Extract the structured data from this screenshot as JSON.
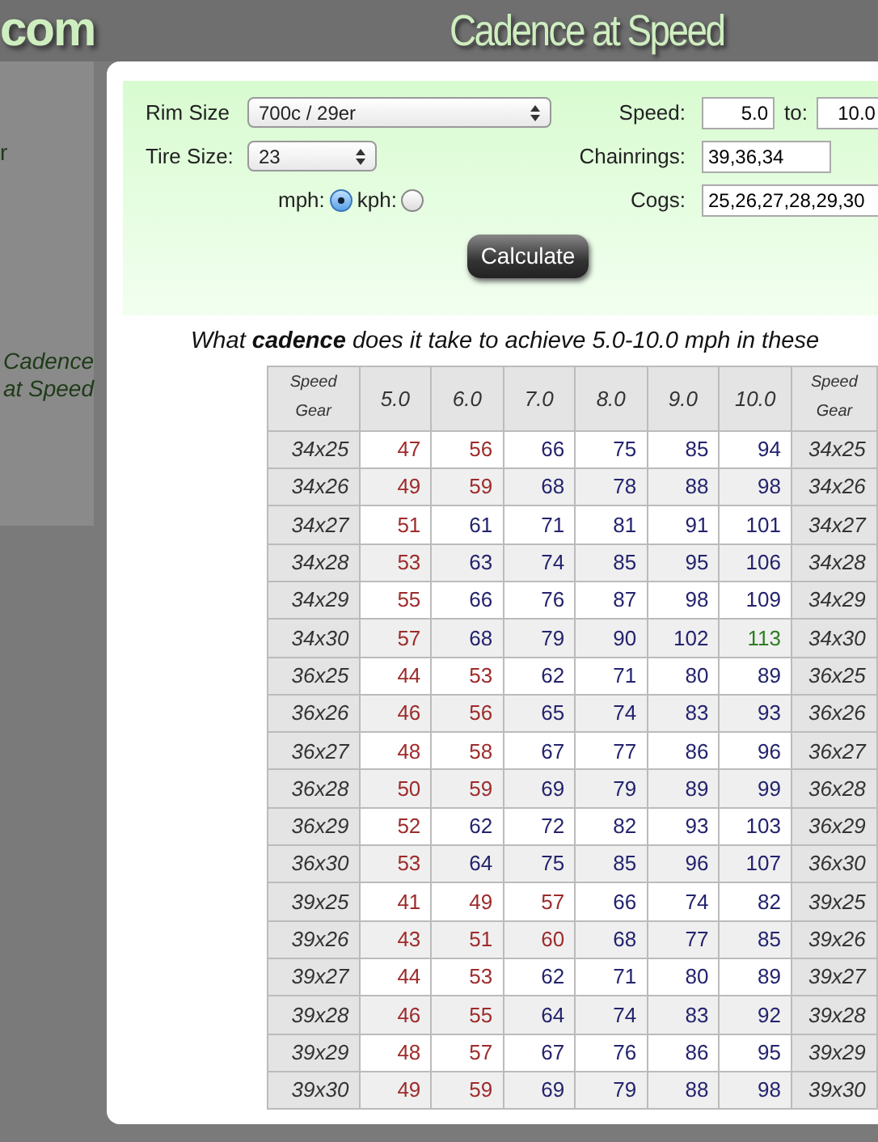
{
  "header": {
    "logo": "com",
    "title": "Cadence at Speed"
  },
  "sidebar": {
    "items": [
      {
        "label": "r",
        "selected": false
      },
      {
        "label": "Cadence at Speed",
        "selected": true
      }
    ]
  },
  "form": {
    "rim_size": {
      "label": "Rim Size",
      "value": "700c / 29er"
    },
    "tire_size": {
      "label": "Tire Size:",
      "value": "23"
    },
    "units": [
      {
        "label": "mph:",
        "selected": true
      },
      {
        "label": "kph:",
        "selected": false
      }
    ],
    "speed": {
      "label": "Speed:",
      "from": "5.0",
      "to_label": "to:",
      "to": "10.0"
    },
    "chainrings": {
      "label": "Chainrings:",
      "value": "39,36,34"
    },
    "cogs": {
      "label": "Cogs:",
      "value": "25,26,27,28,29,30"
    },
    "button": "Calculate"
  },
  "question": "What **cadence** does it take to achieve 5.0-10.0 mph in these",
  "table": {
    "corner_top": "Speed",
    "corner_bottom": "Gear",
    "columns": [
      "5.0",
      "6.0",
      "7.0",
      "8.0",
      "9.0",
      "10.0"
    ],
    "end_top": "Speed",
    "end_bottom": "Gear",
    "rows": [
      {
        "gear_end": "34x25",
        "gear": "34x25",
        "cells": [
          {
            "value": "47",
            "color": "#9e2b2b"
          },
          {
            "value": "56",
            "color": "#9e2b2b"
          },
          {
            "value": "66",
            "color": "#23236e"
          },
          {
            "value": "75",
            "color": "#23236e"
          },
          {
            "value": "85",
            "color": "#23236e"
          },
          {
            "value": "94",
            "color": "#23236e"
          }
        ]
      },
      {
        "gear_end": "34x26",
        "gear": "34x26",
        "cells": [
          {
            "value": "49",
            "color": "#9e2b2b"
          },
          {
            "value": "59",
            "color": "#9e2b2b"
          },
          {
            "value": "68",
            "color": "#23236e"
          },
          {
            "value": "78",
            "color": "#23236e"
          },
          {
            "value": "88",
            "color": "#23236e"
          },
          {
            "value": "98",
            "color": "#23236e"
          }
        ]
      },
      {
        "gear_end": "34x27",
        "gear": "34x27",
        "cells": [
          {
            "value": "51",
            "color": "#9e2b2b"
          },
          {
            "value": "61",
            "color": "#23236e"
          },
          {
            "value": "71",
            "color": "#23236e"
          },
          {
            "value": "81",
            "color": "#23236e"
          },
          {
            "value": "91",
            "color": "#23236e"
          },
          {
            "value": "101",
            "color": "#23236e"
          }
        ]
      },
      {
        "gear_end": "34x28",
        "gear": "34x28",
        "cells": [
          {
            "value": "53",
            "color": "#9e2b2b"
          },
          {
            "value": "63",
            "color": "#23236e"
          },
          {
            "value": "74",
            "color": "#23236e"
          },
          {
            "value": "85",
            "color": "#23236e"
          },
          {
            "value": "95",
            "color": "#23236e"
          },
          {
            "value": "106",
            "color": "#23236e"
          }
        ]
      },
      {
        "gear_end": "34x29",
        "gear": "34x29",
        "cells": [
          {
            "value": "55",
            "color": "#9e2b2b"
          },
          {
            "value": "66",
            "color": "#23236e"
          },
          {
            "value": "76",
            "color": "#23236e"
          },
          {
            "value": "87",
            "color": "#23236e"
          },
          {
            "value": "98",
            "color": "#23236e"
          },
          {
            "value": "109",
            "color": "#23236e"
          }
        ]
      },
      {
        "gear_end": "34x30",
        "gear": "34x30",
        "cells": [
          {
            "value": "57",
            "color": "#9e2b2b"
          },
          {
            "value": "68",
            "color": "#23236e"
          },
          {
            "value": "79",
            "color": "#23236e"
          },
          {
            "value": "90",
            "color": "#23236e"
          },
          {
            "value": "102",
            "color": "#23236e"
          },
          {
            "value": "113",
            "color": "#2e7d23"
          }
        ]
      },
      {
        "gear_end": "36x25",
        "gear": "36x25",
        "cells": [
          {
            "value": "44",
            "color": "#9e2b2b"
          },
          {
            "value": "53",
            "color": "#9e2b2b"
          },
          {
            "value": "62",
            "color": "#23236e"
          },
          {
            "value": "71",
            "color": "#23236e"
          },
          {
            "value": "80",
            "color": "#23236e"
          },
          {
            "value": "89",
            "color": "#23236e"
          }
        ]
      },
      {
        "gear_end": "36x26",
        "gear": "36x26",
        "cells": [
          {
            "value": "46",
            "color": "#9e2b2b"
          },
          {
            "value": "56",
            "color": "#9e2b2b"
          },
          {
            "value": "65",
            "color": "#23236e"
          },
          {
            "value": "74",
            "color": "#23236e"
          },
          {
            "value": "83",
            "color": "#23236e"
          },
          {
            "value": "93",
            "color": "#23236e"
          }
        ]
      },
      {
        "gear_end": "36x27",
        "gear": "36x27",
        "cells": [
          {
            "value": "48",
            "color": "#9e2b2b"
          },
          {
            "value": "58",
            "color": "#9e2b2b"
          },
          {
            "value": "67",
            "color": "#23236e"
          },
          {
            "value": "77",
            "color": "#23236e"
          },
          {
            "value": "86",
            "color": "#23236e"
          },
          {
            "value": "96",
            "color": "#23236e"
          }
        ]
      },
      {
        "gear_end": "36x28",
        "gear": "36x28",
        "cells": [
          {
            "value": "50",
            "color": "#9e2b2b"
          },
          {
            "value": "59",
            "color": "#9e2b2b"
          },
          {
            "value": "69",
            "color": "#23236e"
          },
          {
            "value": "79",
            "color": "#23236e"
          },
          {
            "value": "89",
            "color": "#23236e"
          },
          {
            "value": "99",
            "color": "#23236e"
          }
        ]
      },
      {
        "gear_end": "36x29",
        "gear": "36x29",
        "cells": [
          {
            "value": "52",
            "color": "#9e2b2b"
          },
          {
            "value": "62",
            "color": "#23236e"
          },
          {
            "value": "72",
            "color": "#23236e"
          },
          {
            "value": "82",
            "color": "#23236e"
          },
          {
            "value": "93",
            "color": "#23236e"
          },
          {
            "value": "103",
            "color": "#23236e"
          }
        ]
      },
      {
        "gear_end": "36x30",
        "gear": "36x30",
        "cells": [
          {
            "value": "53",
            "color": "#9e2b2b"
          },
          {
            "value": "64",
            "color": "#23236e"
          },
          {
            "value": "75",
            "color": "#23236e"
          },
          {
            "value": "85",
            "color": "#23236e"
          },
          {
            "value": "96",
            "color": "#23236e"
          },
          {
            "value": "107",
            "color": "#23236e"
          }
        ]
      },
      {
        "gear_end": "39x25",
        "gear": "39x25",
        "cells": [
          {
            "value": "41",
            "color": "#9e2b2b"
          },
          {
            "value": "49",
            "color": "#9e2b2b"
          },
          {
            "value": "57",
            "color": "#9e2b2b"
          },
          {
            "value": "66",
            "color": "#23236e"
          },
          {
            "value": "74",
            "color": "#23236e"
          },
          {
            "value": "82",
            "color": "#23236e"
          }
        ]
      },
      {
        "gear_end": "39x26",
        "gear": "39x26",
        "cells": [
          {
            "value": "43",
            "color": "#9e2b2b"
          },
          {
            "value": "51",
            "color": "#9e2b2b"
          },
          {
            "value": "60",
            "color": "#9e2b2b"
          },
          {
            "value": "68",
            "color": "#23236e"
          },
          {
            "value": "77",
            "color": "#23236e"
          },
          {
            "value": "85",
            "color": "#23236e"
          }
        ]
      },
      {
        "gear_end": "39x27",
        "gear": "39x27",
        "cells": [
          {
            "value": "44",
            "color": "#9e2b2b"
          },
          {
            "value": "53",
            "color": "#9e2b2b"
          },
          {
            "value": "62",
            "color": "#23236e"
          },
          {
            "value": "71",
            "color": "#23236e"
          },
          {
            "value": "80",
            "color": "#23236e"
          },
          {
            "value": "89",
            "color": "#23236e"
          }
        ]
      },
      {
        "gear_end": "39x28",
        "gear": "39x28",
        "cells": [
          {
            "value": "46",
            "color": "#9e2b2b"
          },
          {
            "value": "55",
            "color": "#9e2b2b"
          },
          {
            "value": "64",
            "color": "#23236e"
          },
          {
            "value": "74",
            "color": "#23236e"
          },
          {
            "value": "83",
            "color": "#23236e"
          },
          {
            "value": "92",
            "color": "#23236e"
          }
        ]
      },
      {
        "gear_end": "39x29",
        "gear": "39x29",
        "cells": [
          {
            "value": "48",
            "color": "#9e2b2b"
          },
          {
            "value": "57",
            "color": "#9e2b2b"
          },
          {
            "value": "67",
            "color": "#23236e"
          },
          {
            "value": "76",
            "color": "#23236e"
          },
          {
            "value": "86",
            "color": "#23236e"
          },
          {
            "value": "95",
            "color": "#23236e"
          }
        ]
      },
      {
        "gear_end": "39x30",
        "gear": "39x30",
        "cells": [
          {
            "value": "49",
            "color": "#9e2b2b"
          },
          {
            "value": "59",
            "color": "#9e2b2b"
          },
          {
            "value": "69",
            "color": "#23236e"
          },
          {
            "value": "79",
            "color": "#23236e"
          },
          {
            "value": "88",
            "color": "#23236e"
          },
          {
            "value": "98",
            "color": "#23236e"
          }
        ]
      }
    ]
  }
}
